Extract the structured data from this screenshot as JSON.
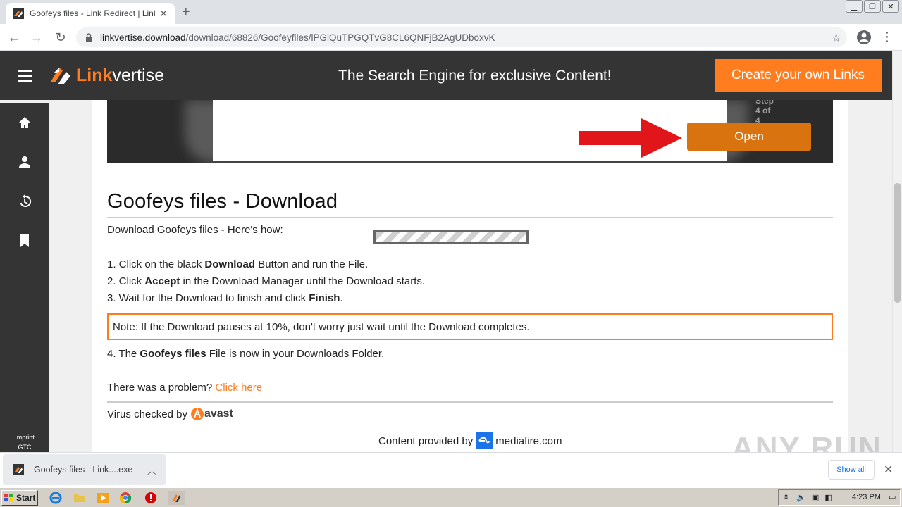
{
  "browser": {
    "tab_title": "Goofeys files - Link Redirect | Linkvertise",
    "url_host": "linkvertise.download",
    "url_path": "/download/68826/Goofeyfiles/lPGlQuTPGQTvG8CL6QNFjB2AgUDboxvK",
    "new_tab_symbol": "+",
    "tab_close_symbol": "✕"
  },
  "header": {
    "logo_part1": "Link",
    "logo_part2": "vertise",
    "tagline": "The Search Engine for exclusive Content!",
    "cta": "Create your own Links"
  },
  "sidebar": {
    "items": [
      "home-icon",
      "user-icon",
      "history-icon",
      "bookmark-icon"
    ],
    "imprint": "Imprint",
    "gtc": "GTC"
  },
  "banner": {
    "step_text": "Step 4 of 4",
    "open_label": "Open"
  },
  "main": {
    "title": "Goofeys files - Download",
    "howto": "Download Goofeys files - Here's how:",
    "step1_a": "1. Click on the black ",
    "step1_b": "Download",
    "step1_c": " Button and run the File.",
    "step2_a": "2. Click ",
    "step2_b": "Accept",
    "step2_c": " in the Download Manager until the Download starts.",
    "step3_a": "3. Wait for the Download to finish and click ",
    "step3_b": "Finish",
    "step3_c": ".",
    "note": "Note: If the Download pauses at 10%, don't worry just wait until the Download completes.",
    "step4_a": "4. The ",
    "step4_b": "Goofeys files",
    "step4_c": " File is now in your Downloads Folder.",
    "problem_text": "There was a problem? ",
    "problem_link": "Click here",
    "virus_text": "Virus checked by",
    "avast": "avast",
    "provided_text": "Content provided by",
    "mediafire": "mediafire.com"
  },
  "download_shelf": {
    "file_name": "Goofeys files - Link....exe",
    "show_all": "Show all"
  },
  "taskbar": {
    "start": "Start",
    "clock": "4:23 PM"
  },
  "watermark": "ANY RUN",
  "colors": {
    "brand_orange": "#ff7c1f",
    "header_dark": "#343434"
  }
}
